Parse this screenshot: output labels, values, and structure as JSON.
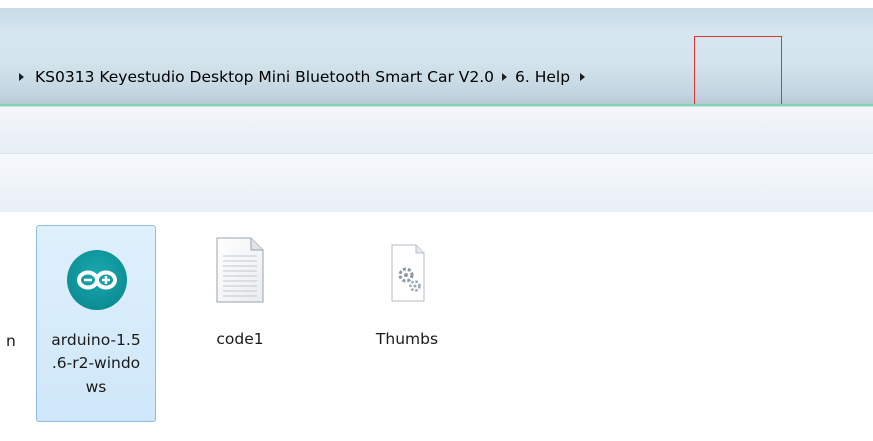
{
  "breadcrumb": {
    "items": [
      {
        "label": "KS0313 Keyestudio Desktop Mini Bluetooth Smart Car V2.0"
      },
      {
        "label": "6. Help"
      }
    ]
  },
  "files": {
    "partial_label": "n",
    "items": [
      {
        "name_lines": [
          "arduino-1.5",
          ".6-r2-windo",
          "ws"
        ],
        "icon": "arduino-icon",
        "selected": true
      },
      {
        "name_lines": [
          "code1"
        ],
        "icon": "text-document-icon",
        "selected": false
      },
      {
        "name_lines": [
          "Thumbs"
        ],
        "icon": "system-file-icon",
        "selected": false
      }
    ]
  },
  "colors": {
    "highlight_box": "#e03535",
    "selection": "#cfe7f9",
    "arduino_teal": "#0c8f95"
  }
}
